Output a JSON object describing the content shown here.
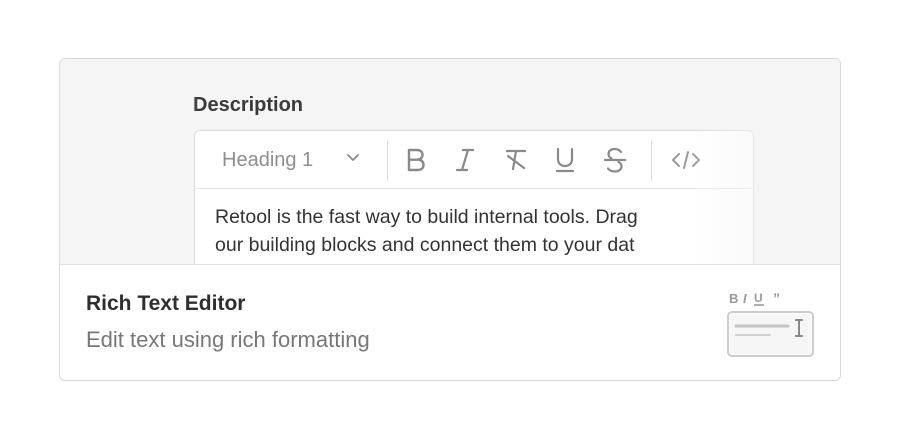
{
  "preview": {
    "field_label": "Description",
    "toolbar": {
      "heading_select": "Heading 1",
      "buttons": [
        {
          "icon": "bold-icon",
          "label": "B"
        },
        {
          "icon": "italic-icon",
          "label": "I"
        },
        {
          "icon": "clear-format-icon",
          "label": ""
        },
        {
          "icon": "underline-icon",
          "label": "U"
        },
        {
          "icon": "strikethrough-icon",
          "label": "S"
        },
        {
          "icon": "code-icon",
          "label": "</>"
        }
      ]
    },
    "content_lines": [
      "Retool is the fast way to build internal tools. Drag",
      "our building blocks and connect them to your dat"
    ]
  },
  "component": {
    "title": "Rich Text Editor",
    "description": "Edit text using rich formatting",
    "thumbnail_icon": "rich-text-editor-icon"
  },
  "colors": {
    "preview_bg": "#f5f5f5",
    "border": "#d9d9d9",
    "icon_gray": "#8a8a8a",
    "title": "#2e2e2e",
    "description": "#777777"
  }
}
